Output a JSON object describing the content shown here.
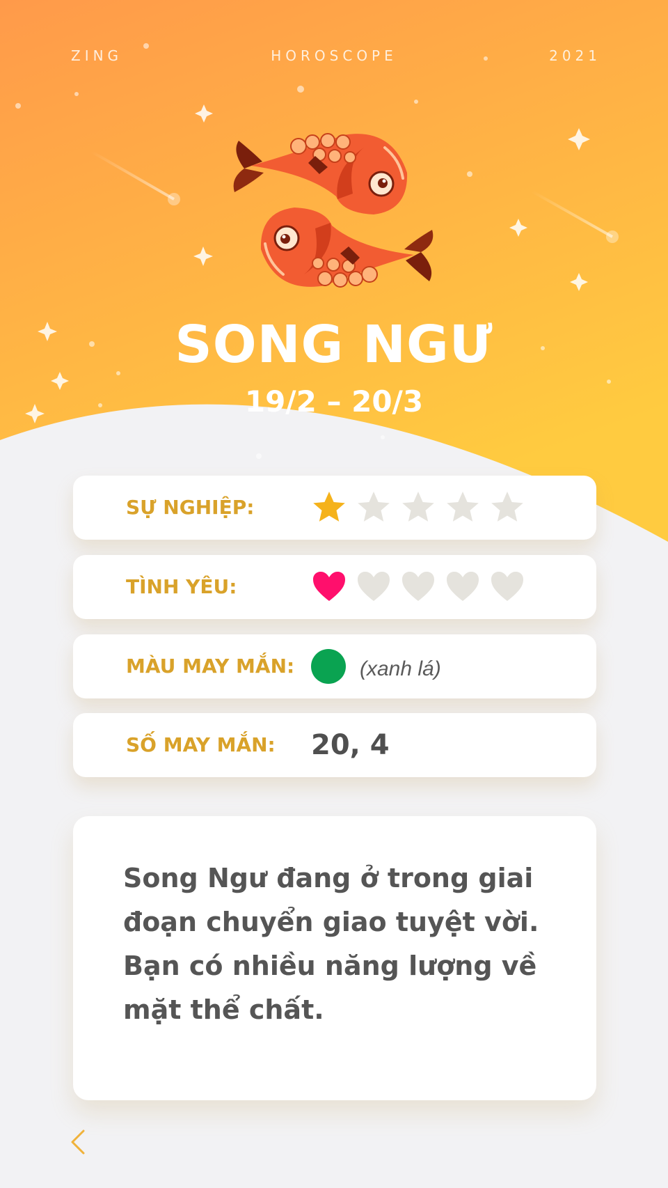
{
  "header": {
    "left": "ZING",
    "center": "HOROSCOPE",
    "right": "2021"
  },
  "sign": {
    "name": "SONG NGƯ",
    "dates": "19/2 – 20/3",
    "icon": "pisces-fish-icon"
  },
  "ratings": [
    {
      "label": "SỰ NGHIỆP:",
      "icon": "star-icon",
      "filled": 1,
      "total": 5,
      "color": "#f5b21b"
    },
    {
      "label": "TÌNH YÊU:",
      "icon": "heart-icon",
      "filled": 1,
      "total": 5,
      "color": "#ff0f6c"
    }
  ],
  "lucky_color": {
    "label": "MÀU MAY MẮN:",
    "swatch": "#0aa351",
    "name": "(xanh lá)"
  },
  "lucky_number": {
    "label": "SỐ MAY MẮN:",
    "value": "20, 4"
  },
  "description": "Song Ngư đang ở trong giai đoạn chuyển giao tuyệt vời. Bạn có nhiều năng lượng về mặt thể chất.",
  "colors": {
    "hero_top": "#ff9a4a",
    "hero_bottom": "#ffcb40",
    "label": "#d9a22a",
    "empty_mark": "#e5e3dd",
    "page_bg": "#f2f2f4"
  },
  "nav": {
    "back_icon": "chevron-left-icon"
  }
}
